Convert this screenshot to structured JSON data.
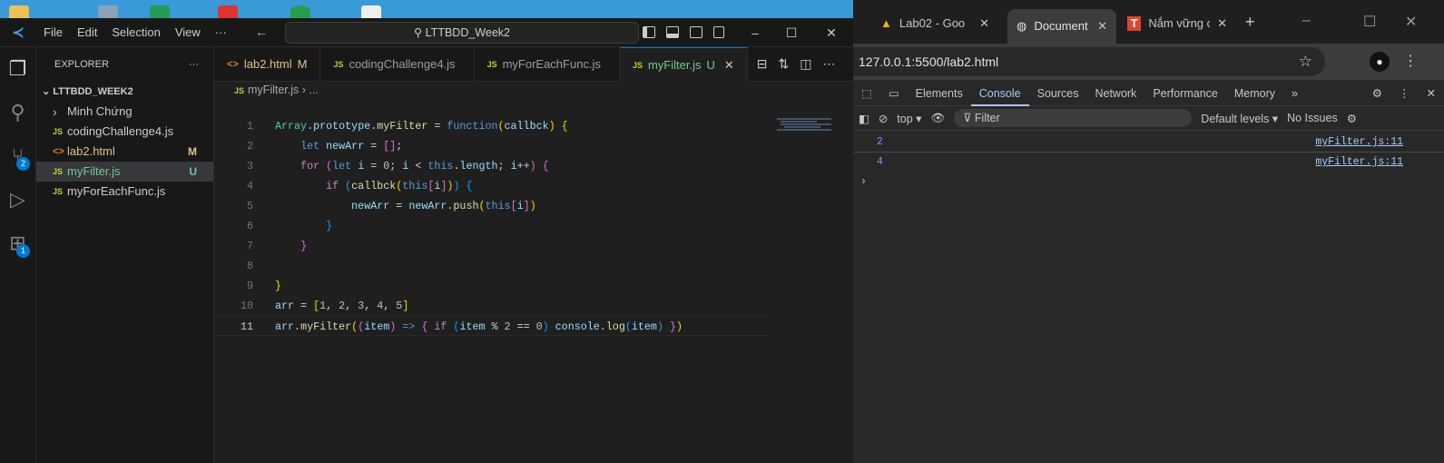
{
  "vscode": {
    "menu": [
      "File",
      "Edit",
      "Selection",
      "View",
      "···"
    ],
    "command_center": "LTTBDD_Week2",
    "explorer": {
      "title": "EXPLORER",
      "more": "···",
      "root": "LTTBDD_WEEK2",
      "items": [
        {
          "label": "Minh Chứng",
          "type": "folder",
          "status": ""
        },
        {
          "label": "codingChallenge4.js",
          "type": "js",
          "status": ""
        },
        {
          "label": "lab2.html",
          "type": "html",
          "status": "M",
          "status_color": "#e2c08d",
          "label_color": "#e2c08d"
        },
        {
          "label": "myFilter.js",
          "type": "js",
          "status": "U",
          "status_color": "#73c991",
          "label_color": "#73c991",
          "selected": true
        },
        {
          "label": "myForEachFunc.js",
          "type": "js",
          "status": ""
        }
      ]
    },
    "activity_badges": {
      "source_control": "2",
      "extensions": "1"
    },
    "tabs": [
      {
        "label": "lab2.html",
        "type": "html",
        "status": "M",
        "color": "#e2c08d"
      },
      {
        "label": "codingChallenge4.js",
        "type": "js",
        "status": ""
      },
      {
        "label": "myForEachFunc.js",
        "type": "js",
        "status": ""
      },
      {
        "label": "myFilter.js",
        "type": "js",
        "status": "U",
        "color": "#73c991",
        "active": true
      }
    ],
    "breadcrumb": {
      "file": "myFilter.js",
      "rest": "› ..."
    },
    "current_line": 11,
    "code": [
      [
        [
          "Array",
          "c"
        ],
        [
          ".",
          "p"
        ],
        [
          "prototype",
          "v"
        ],
        [
          ".",
          "p"
        ],
        [
          "myFilter",
          "f"
        ],
        [
          " = ",
          "p"
        ],
        [
          "function",
          "k"
        ],
        [
          "(",
          "b1"
        ],
        [
          "callbck",
          "v"
        ],
        [
          ")",
          "b1"
        ],
        [
          " ",
          "p"
        ],
        [
          "{",
          "b1"
        ]
      ],
      [
        [
          "    ",
          "p"
        ],
        [
          "let",
          "k"
        ],
        [
          " newArr",
          "v"
        ],
        [
          " = ",
          "p"
        ],
        [
          "[]",
          "b2"
        ],
        [
          ";",
          "p"
        ]
      ],
      [
        [
          "    ",
          "p"
        ],
        [
          "for",
          "kc"
        ],
        [
          " ",
          "p"
        ],
        [
          "(",
          "b2"
        ],
        [
          "let",
          "k"
        ],
        [
          " i",
          "v"
        ],
        [
          " = ",
          "p"
        ],
        [
          "0",
          "n"
        ],
        [
          "; ",
          "p"
        ],
        [
          "i",
          "v"
        ],
        [
          " < ",
          "p"
        ],
        [
          "this",
          "k"
        ],
        [
          ".",
          "p"
        ],
        [
          "length",
          "v"
        ],
        [
          "; ",
          "p"
        ],
        [
          "i",
          "v"
        ],
        [
          "++",
          "p"
        ],
        [
          ")",
          "b2"
        ],
        [
          " ",
          "p"
        ],
        [
          "{",
          "b2"
        ]
      ],
      [
        [
          "        ",
          "p"
        ],
        [
          "if",
          "kc"
        ],
        [
          " ",
          "p"
        ],
        [
          "(",
          "b3"
        ],
        [
          "callbck",
          "f"
        ],
        [
          "(",
          "b1"
        ],
        [
          "this",
          "k"
        ],
        [
          "[",
          "b2"
        ],
        [
          "i",
          "v"
        ],
        [
          "]",
          "b2"
        ],
        [
          ")",
          "b1"
        ],
        [
          ")",
          "b3"
        ],
        [
          " ",
          "p"
        ],
        [
          "{",
          "b3"
        ]
      ],
      [
        [
          "            ",
          "p"
        ],
        [
          "newArr",
          "v"
        ],
        [
          " = ",
          "p"
        ],
        [
          "newArr",
          "v"
        ],
        [
          ".",
          "p"
        ],
        [
          "push",
          "f"
        ],
        [
          "(",
          "b1"
        ],
        [
          "this",
          "k"
        ],
        [
          "[",
          "b2"
        ],
        [
          "i",
          "v"
        ],
        [
          "]",
          "b2"
        ],
        [
          ")",
          "b1"
        ]
      ],
      [
        [
          "        ",
          "p"
        ],
        [
          "}",
          "b3"
        ]
      ],
      [
        [
          "    ",
          "p"
        ],
        [
          "}",
          "b2"
        ]
      ],
      [],
      [
        [
          "}",
          "b1"
        ]
      ],
      [
        [
          "arr",
          "v"
        ],
        [
          " = ",
          "p"
        ],
        [
          "[",
          "b1"
        ],
        [
          "1",
          "n"
        ],
        [
          ", ",
          "p"
        ],
        [
          "2",
          "n"
        ],
        [
          ", ",
          "p"
        ],
        [
          "3",
          "n"
        ],
        [
          ", ",
          "p"
        ],
        [
          "4",
          "n"
        ],
        [
          ", ",
          "p"
        ],
        [
          "5",
          "n"
        ],
        [
          "]",
          "b1"
        ]
      ],
      [
        [
          "arr",
          "v"
        ],
        [
          ".",
          "p"
        ],
        [
          "myFilter",
          "f"
        ],
        [
          "(",
          "b1"
        ],
        [
          "(",
          "b2"
        ],
        [
          "item",
          "v"
        ],
        [
          ")",
          "b2"
        ],
        [
          " => ",
          "k"
        ],
        [
          "{",
          "b2"
        ],
        [
          " ",
          "p"
        ],
        [
          "if",
          "kc"
        ],
        [
          " ",
          "p"
        ],
        [
          "(",
          "b3"
        ],
        [
          "item",
          "v"
        ],
        [
          " % ",
          "p"
        ],
        [
          "2",
          "n"
        ],
        [
          " == ",
          "p"
        ],
        [
          "0",
          "n"
        ],
        [
          ")",
          "b3"
        ],
        [
          " ",
          "p"
        ],
        [
          "console",
          "v"
        ],
        [
          ".",
          "p"
        ],
        [
          "log",
          "f"
        ],
        [
          "(",
          "b3"
        ],
        [
          "item",
          "v"
        ],
        [
          ")",
          "b3"
        ],
        [
          " ",
          "p"
        ],
        [
          "}",
          "b2"
        ],
        [
          ")",
          "b1"
        ]
      ]
    ]
  },
  "chrome": {
    "tabs": [
      {
        "label": "Lab02 - Goo",
        "icon": "google-drive-icon"
      },
      {
        "label": "Document",
        "icon": "globe-icon",
        "active": true
      },
      {
        "label": "Nắm vững c",
        "icon": "t-icon"
      }
    ],
    "new_tab": "+",
    "url": "127.0.0.1:5500/lab2.html",
    "devtools_tabs": [
      "Elements",
      "Console",
      "Sources",
      "Network",
      "Performance",
      "Memory"
    ],
    "active_devtools_tab": "Console",
    "context": "top ▾",
    "filter_placeholder": "Filter",
    "levels": "Default levels ▾",
    "issues": "No Issues",
    "console": [
      {
        "value": "2",
        "source": "myFilter.js:11"
      },
      {
        "value": "4",
        "source": "myFilter.js:11"
      }
    ],
    "prompt": "›"
  }
}
